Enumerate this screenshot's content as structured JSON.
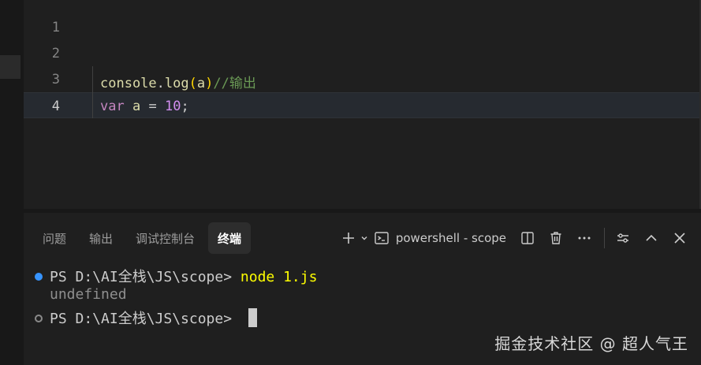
{
  "editor": {
    "breadcrumb_stub": "",
    "lines": [
      {
        "number": "1"
      },
      {
        "number": "2"
      },
      {
        "number": "3",
        "tokens": {
          "obj": "console",
          "dot": ".",
          "fn": "log",
          "open": "(",
          "arg": "a",
          "close": ")",
          "comment": "//输出"
        }
      },
      {
        "number": "4",
        "tokens": {
          "kw": "var",
          "id": "a",
          "op": "=",
          "num": "10",
          "semi": ";"
        }
      }
    ]
  },
  "panel": {
    "tabs": [
      {
        "label": "问题"
      },
      {
        "label": "输出"
      },
      {
        "label": "调试控制台"
      },
      {
        "label": "终端",
        "active": true
      }
    ],
    "terminal_name": "powershell - scope",
    "icons": {
      "new_terminal": "plus-icon",
      "dropdown": "chevron-down-icon",
      "terminal": "terminal-icon",
      "split": "split-icon",
      "kill": "trash-icon",
      "more": "ellipsis-icon",
      "customize": "sliders-icon",
      "maximize": "chevron-up-icon",
      "close": "close-icon"
    }
  },
  "terminal": {
    "lines": [
      {
        "prompt": "PS D:\\AI全栈\\JS\\scope> ",
        "command": "node 1.js",
        "status": "success"
      },
      {
        "output": "undefined"
      },
      {
        "prompt": "PS D:\\AI全栈\\JS\\scope> ",
        "command": "",
        "status": "pending"
      }
    ]
  },
  "watermark": "掘金技术社区 @ 超人气王",
  "colors": {
    "background": "#1f1f1f",
    "command": "#ffff00",
    "success_dot": "#3794ff",
    "keyword": "#c586c0",
    "number": "#d38ef0"
  }
}
